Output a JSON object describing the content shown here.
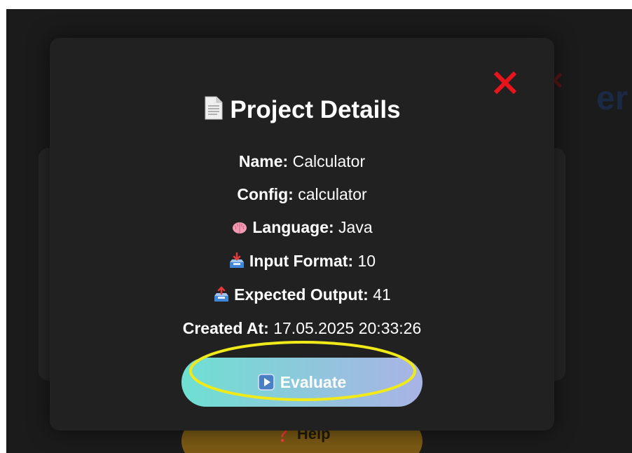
{
  "background": {
    "heading_fragment": "er",
    "close_glyph": "✕",
    "help_button_label": "❓ Help"
  },
  "modal": {
    "title": "Project Details",
    "title_icon": "page-icon",
    "close_icon": "close-icon",
    "fields": {
      "name": {
        "label": "Name:",
        "value": "Calculator"
      },
      "config": {
        "label": "Config:",
        "value": "calculator"
      },
      "language": {
        "label": "Language:",
        "value": "Java",
        "icon": "brain-icon"
      },
      "input_format": {
        "label": "Input Format:",
        "value": "10",
        "icon": "inbox-tray-icon"
      },
      "expected_output": {
        "label": "Expected Output:",
        "value": "41",
        "icon": "outbox-tray-icon"
      },
      "created_at": {
        "label": "Created At:",
        "value": "17.05.2025 20:33:26"
      }
    },
    "evaluate_button": {
      "label": "Evaluate",
      "icon": "play-button-icon"
    }
  },
  "colors": {
    "modal_bg": "#212121",
    "close_red": "#e8141b",
    "evaluate_gradient_start": "#6ee0d2",
    "evaluate_gradient_end": "#a9b3e6",
    "highlight_yellow": "#f0ea1a"
  }
}
